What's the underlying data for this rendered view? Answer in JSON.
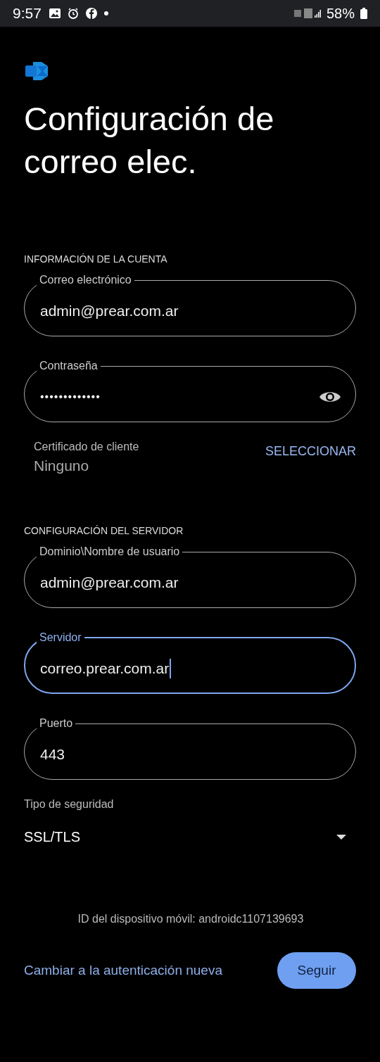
{
  "status_bar": {
    "time": "9:57",
    "battery": "58%"
  },
  "title": "Configuración de correo elec.",
  "account_section": {
    "heading": "INFORMACIÓN DE LA CUENTA",
    "fields": [
      {
        "kind": "text",
        "label": "Correo electrónico",
        "value": "admin@prear.com.ar",
        "focused": false
      },
      {
        "kind": "password",
        "label": "Contraseña",
        "value": "•••••••••••••",
        "focused": false
      }
    ]
  },
  "certificate": {
    "label": "Certificado de cliente",
    "value": "Ninguno",
    "action": "SELECCIONAR"
  },
  "server_section": {
    "heading": "CONFIGURACIÓN DEL SERVIDOR",
    "fields": [
      {
        "kind": "text",
        "label": "Dominio\\Nombre de usuario",
        "value": "admin@prear.com.ar",
        "focused": false
      },
      {
        "kind": "text",
        "label": "Servidor",
        "value": "correo.prear.com.ar",
        "focused": true
      },
      {
        "kind": "text",
        "label": "Puerto",
        "value": "443",
        "focused": false
      }
    ]
  },
  "security": {
    "label": "Tipo de seguridad",
    "value": "SSL/TLS"
  },
  "device_id": "ID del dispositivo móvil: androidc1107139693",
  "switch_link": "Cambiar a la autenticación nueva",
  "next_button": "Seguir"
}
